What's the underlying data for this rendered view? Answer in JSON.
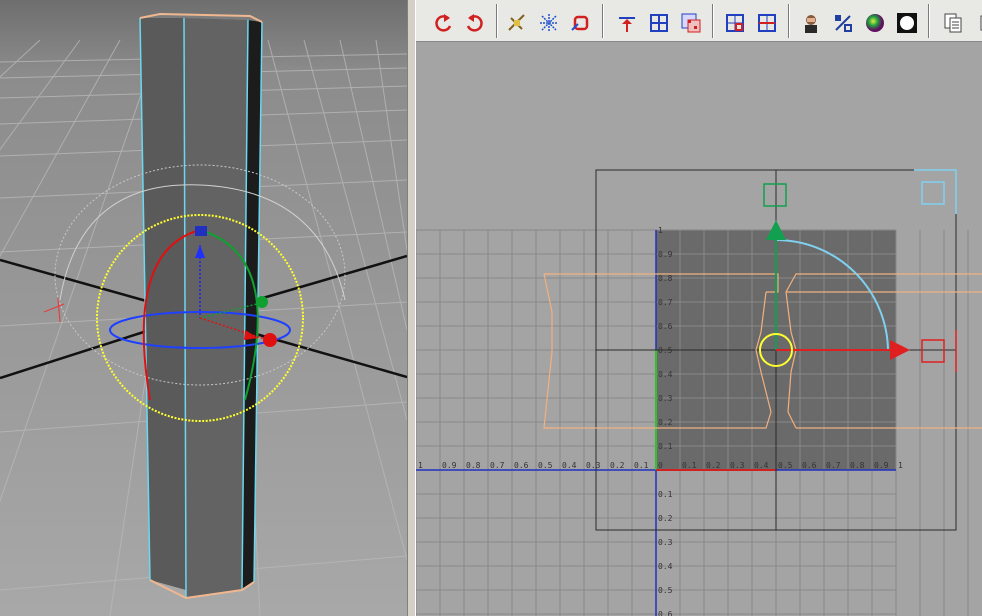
{
  "uv_editor": {
    "x_ticks_neg": [
      "1",
      "0.9",
      "0.8",
      "0.7",
      "0.6",
      "0.5",
      "0.4",
      "0.3",
      "0.2",
      "0.1"
    ],
    "x_ticks_pos": [
      "0",
      "0.1",
      "0.2",
      "0.3",
      "0.4",
      "0.5",
      "0.6",
      "0.7",
      "0.8",
      "0.9",
      "1"
    ],
    "y_ticks_pos": [
      "1",
      "0.9",
      "0.8",
      "0.7",
      "0.6",
      "0.5",
      "0.4",
      "0.3",
      "0.2",
      "0.1"
    ],
    "y_ticks_neg": [
      "0.1",
      "0.2",
      "0.3",
      "0.4",
      "0.5",
      "0.6"
    ]
  },
  "toolbar": {
    "buttons": [
      "rotate-ccw-icon",
      "rotate-cw-icon",
      "cut-uv-icon",
      "unfold-uv-icon",
      "layout-uv-icon",
      "align-top-icon",
      "grid-uv-icon",
      "checker-map-icon",
      "shell-select-icon",
      "border-select-icon",
      "texture-image-icon",
      "percent-icon",
      "color-sphere-icon",
      "black-sphere-icon",
      "copy-page-icon"
    ]
  }
}
